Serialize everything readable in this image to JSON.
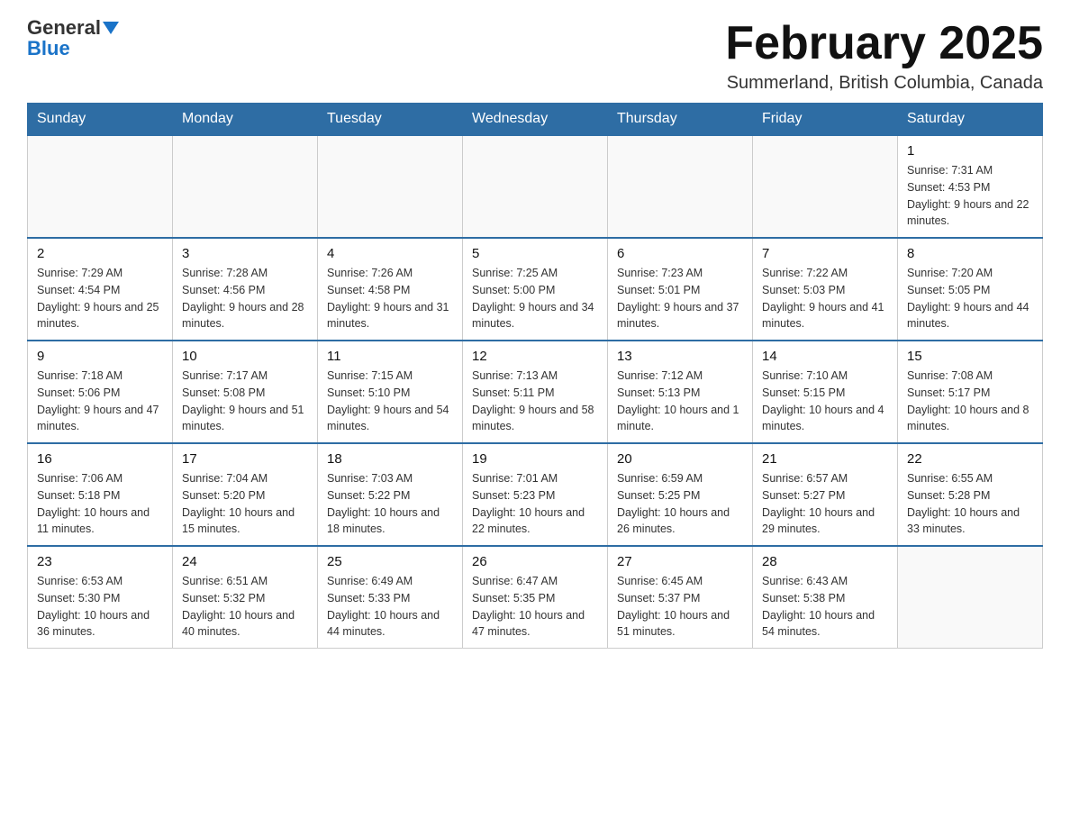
{
  "header": {
    "logo_general": "General",
    "logo_blue": "Blue",
    "month_title": "February 2025",
    "location": "Summerland, British Columbia, Canada"
  },
  "weekdays": [
    "Sunday",
    "Monday",
    "Tuesday",
    "Wednesday",
    "Thursday",
    "Friday",
    "Saturday"
  ],
  "weeks": [
    [
      {
        "day": "",
        "info": ""
      },
      {
        "day": "",
        "info": ""
      },
      {
        "day": "",
        "info": ""
      },
      {
        "day": "",
        "info": ""
      },
      {
        "day": "",
        "info": ""
      },
      {
        "day": "",
        "info": ""
      },
      {
        "day": "1",
        "info": "Sunrise: 7:31 AM\nSunset: 4:53 PM\nDaylight: 9 hours and 22 minutes."
      }
    ],
    [
      {
        "day": "2",
        "info": "Sunrise: 7:29 AM\nSunset: 4:54 PM\nDaylight: 9 hours and 25 minutes."
      },
      {
        "day": "3",
        "info": "Sunrise: 7:28 AM\nSunset: 4:56 PM\nDaylight: 9 hours and 28 minutes."
      },
      {
        "day": "4",
        "info": "Sunrise: 7:26 AM\nSunset: 4:58 PM\nDaylight: 9 hours and 31 minutes."
      },
      {
        "day": "5",
        "info": "Sunrise: 7:25 AM\nSunset: 5:00 PM\nDaylight: 9 hours and 34 minutes."
      },
      {
        "day": "6",
        "info": "Sunrise: 7:23 AM\nSunset: 5:01 PM\nDaylight: 9 hours and 37 minutes."
      },
      {
        "day": "7",
        "info": "Sunrise: 7:22 AM\nSunset: 5:03 PM\nDaylight: 9 hours and 41 minutes."
      },
      {
        "day": "8",
        "info": "Sunrise: 7:20 AM\nSunset: 5:05 PM\nDaylight: 9 hours and 44 minutes."
      }
    ],
    [
      {
        "day": "9",
        "info": "Sunrise: 7:18 AM\nSunset: 5:06 PM\nDaylight: 9 hours and 47 minutes."
      },
      {
        "day": "10",
        "info": "Sunrise: 7:17 AM\nSunset: 5:08 PM\nDaylight: 9 hours and 51 minutes."
      },
      {
        "day": "11",
        "info": "Sunrise: 7:15 AM\nSunset: 5:10 PM\nDaylight: 9 hours and 54 minutes."
      },
      {
        "day": "12",
        "info": "Sunrise: 7:13 AM\nSunset: 5:11 PM\nDaylight: 9 hours and 58 minutes."
      },
      {
        "day": "13",
        "info": "Sunrise: 7:12 AM\nSunset: 5:13 PM\nDaylight: 10 hours and 1 minute."
      },
      {
        "day": "14",
        "info": "Sunrise: 7:10 AM\nSunset: 5:15 PM\nDaylight: 10 hours and 4 minutes."
      },
      {
        "day": "15",
        "info": "Sunrise: 7:08 AM\nSunset: 5:17 PM\nDaylight: 10 hours and 8 minutes."
      }
    ],
    [
      {
        "day": "16",
        "info": "Sunrise: 7:06 AM\nSunset: 5:18 PM\nDaylight: 10 hours and 11 minutes."
      },
      {
        "day": "17",
        "info": "Sunrise: 7:04 AM\nSunset: 5:20 PM\nDaylight: 10 hours and 15 minutes."
      },
      {
        "day": "18",
        "info": "Sunrise: 7:03 AM\nSunset: 5:22 PM\nDaylight: 10 hours and 18 minutes."
      },
      {
        "day": "19",
        "info": "Sunrise: 7:01 AM\nSunset: 5:23 PM\nDaylight: 10 hours and 22 minutes."
      },
      {
        "day": "20",
        "info": "Sunrise: 6:59 AM\nSunset: 5:25 PM\nDaylight: 10 hours and 26 minutes."
      },
      {
        "day": "21",
        "info": "Sunrise: 6:57 AM\nSunset: 5:27 PM\nDaylight: 10 hours and 29 minutes."
      },
      {
        "day": "22",
        "info": "Sunrise: 6:55 AM\nSunset: 5:28 PM\nDaylight: 10 hours and 33 minutes."
      }
    ],
    [
      {
        "day": "23",
        "info": "Sunrise: 6:53 AM\nSunset: 5:30 PM\nDaylight: 10 hours and 36 minutes."
      },
      {
        "day": "24",
        "info": "Sunrise: 6:51 AM\nSunset: 5:32 PM\nDaylight: 10 hours and 40 minutes."
      },
      {
        "day": "25",
        "info": "Sunrise: 6:49 AM\nSunset: 5:33 PM\nDaylight: 10 hours and 44 minutes."
      },
      {
        "day": "26",
        "info": "Sunrise: 6:47 AM\nSunset: 5:35 PM\nDaylight: 10 hours and 47 minutes."
      },
      {
        "day": "27",
        "info": "Sunrise: 6:45 AM\nSunset: 5:37 PM\nDaylight: 10 hours and 51 minutes."
      },
      {
        "day": "28",
        "info": "Sunrise: 6:43 AM\nSunset: 5:38 PM\nDaylight: 10 hours and 54 minutes."
      },
      {
        "day": "",
        "info": ""
      }
    ]
  ]
}
